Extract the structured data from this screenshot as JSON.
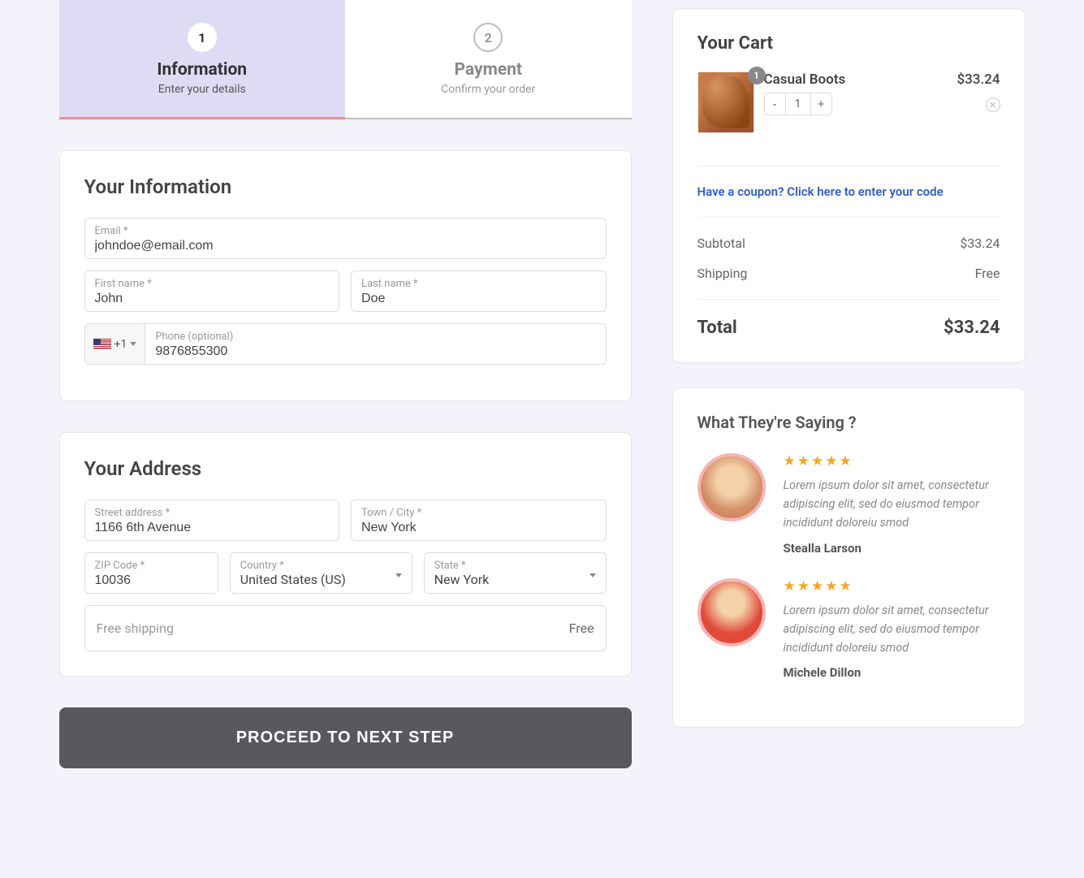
{
  "steps": [
    {
      "num": "1",
      "title": "Information",
      "sub": "Enter your details"
    },
    {
      "num": "2",
      "title": "Payment",
      "sub": "Confirm your order"
    }
  ],
  "infoSection": {
    "heading": "Your Information",
    "email": {
      "label": "Email *",
      "value": "johndoe@email.com"
    },
    "first": {
      "label": "First name *",
      "value": "John"
    },
    "last": {
      "label": "Last name *",
      "value": "Doe"
    },
    "phone": {
      "label": "Phone (optional)",
      "value": "9876855300",
      "prefix": "+1"
    }
  },
  "addressSection": {
    "heading": "Your Address",
    "street": {
      "label": "Street address *",
      "value": "1166 6th Avenue"
    },
    "city": {
      "label": "Town / City *",
      "value": "New York"
    },
    "zip": {
      "label": "ZIP Code *",
      "value": "10036"
    },
    "country": {
      "label": "Country *",
      "value": "United States (US)"
    },
    "state": {
      "label": "State *",
      "value": "New York"
    },
    "shipping": {
      "label": "Free shipping",
      "value": "Free"
    }
  },
  "proceed": "PROCEED TO NEXT STEP",
  "cart": {
    "heading": "Your Cart",
    "item": {
      "badge": "1",
      "name": "Casual Boots",
      "price": "$33.24",
      "qty": "1"
    },
    "coupon": "Have a coupon? Click here to enter your code",
    "subtotal": {
      "label": "Subtotal",
      "value": "$33.24"
    },
    "shipping": {
      "label": "Shipping",
      "value": "Free"
    },
    "total": {
      "label": "Total",
      "value": "$33.24"
    }
  },
  "testimonials": {
    "heading": "What They're Saying ?",
    "items": [
      {
        "stars": "★★★★★",
        "text": "Lorem ipsum dolor sit amet, consectetur adipiscing elit, sed do eiusmod tempor incididunt doloreiu smod",
        "name": "Stealla Larson"
      },
      {
        "stars": "★★★★★",
        "text": "Lorem ipsum dolor sit amet, consectetur adipiscing elit, sed do eiusmod tempor incididunt doloreiu smod",
        "name": "Michele Dillon"
      }
    ]
  }
}
